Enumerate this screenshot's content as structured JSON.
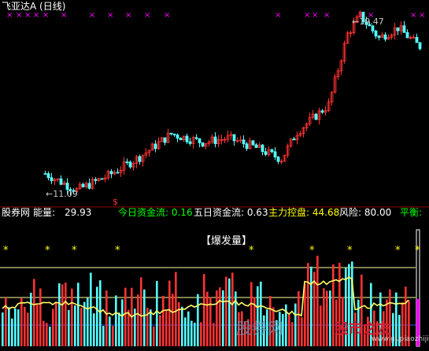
{
  "chart_title": "飞亚达A (日线)",
  "high_label": "←19.47",
  "low_label": "←11.09",
  "signal_glyph": "$",
  "indicator_bar": {
    "site": "股券网",
    "volume_label": "能量:",
    "volume_value": "29.93",
    "today_flow": "今日资金流: 0.16",
    "five_day_flow": "五日资金流: 0.63",
    "main_control": "主力控盘: 44.68",
    "risk": "风险: 80.00",
    "balance": "平衡:"
  },
  "panel_title": "【爆发量】",
  "watermark": {
    "site_text": "股券网",
    "logo_text": "股市之友",
    "url_text": "www.gupiaozhijia.net"
  },
  "colors": {
    "up": "#ff3232",
    "down": "#54ffff",
    "marker": "#ff00ff",
    "star": "#ffff00",
    "line": "#ffff66",
    "level": "#ffffa0"
  },
  "chart_data": {
    "type": "candlestick",
    "candle_count": 120,
    "price_range": [
      11.09,
      19.47
    ],
    "top_markers": [
      "×",
      "×",
      "×",
      "×",
      "×",
      "×",
      "×",
      "×",
      "×",
      "×",
      "×",
      "×",
      "×",
      "×",
      "×",
      "×",
      "×",
      "×",
      "×"
    ],
    "bottom_star": "*",
    "bottom_star_count": 9
  }
}
